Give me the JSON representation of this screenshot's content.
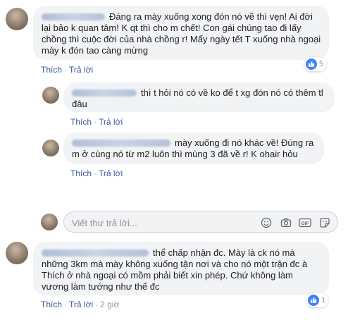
{
  "comments": [
    {
      "text": "Đáng ra mày xuống xong đón nó về thì vẹn! Ai đời lại bảo k quan tâm! K qt thì cho m chết! Con gái chúng tao đi lấy chồng thì cuộc đời của nhà chồng r! Mấy ngày tết T xuống nhà ngoại mày k đón tao càng mừng",
      "like": "Thích",
      "reply": "Trả lời",
      "reactions": "5"
    },
    {
      "text": "thì t hỏi nó có về ko để t xg đón nó có thêm tl đâu",
      "like": "Thích",
      "reply": "Trả lời"
    },
    {
      "text": "mày xuống đi nó khác về! Đúng ra m ở cùng nó từ m2 luôn thì mùng 3 đã về r! K ohair hỏu",
      "like": "Thích",
      "reply": "Trả lời"
    },
    {
      "text": "thể chấp nhận đc. Mày là ck nó mà những 3km mà mày không xuống tận nơi và cho nó một trận đc à Thích ở nhà ngoại có mồm phải biết xin phép. Chứ không làm vương làm tướng như thế đc",
      "like": "Thích",
      "reply": "Trả lời",
      "time": "2 giờ",
      "reactions": "1"
    }
  ],
  "reply_box": {
    "placeholder": "Viết thư trả lời..."
  },
  "colors": {
    "link": "#385898",
    "bubble": "#f2f3f5",
    "like_blue": "#4080ff",
    "meta": "#90949c"
  },
  "icons": [
    "thumbs-up-icon",
    "emoji-icon",
    "camera-icon",
    "gif-icon",
    "sticker-icon"
  ]
}
